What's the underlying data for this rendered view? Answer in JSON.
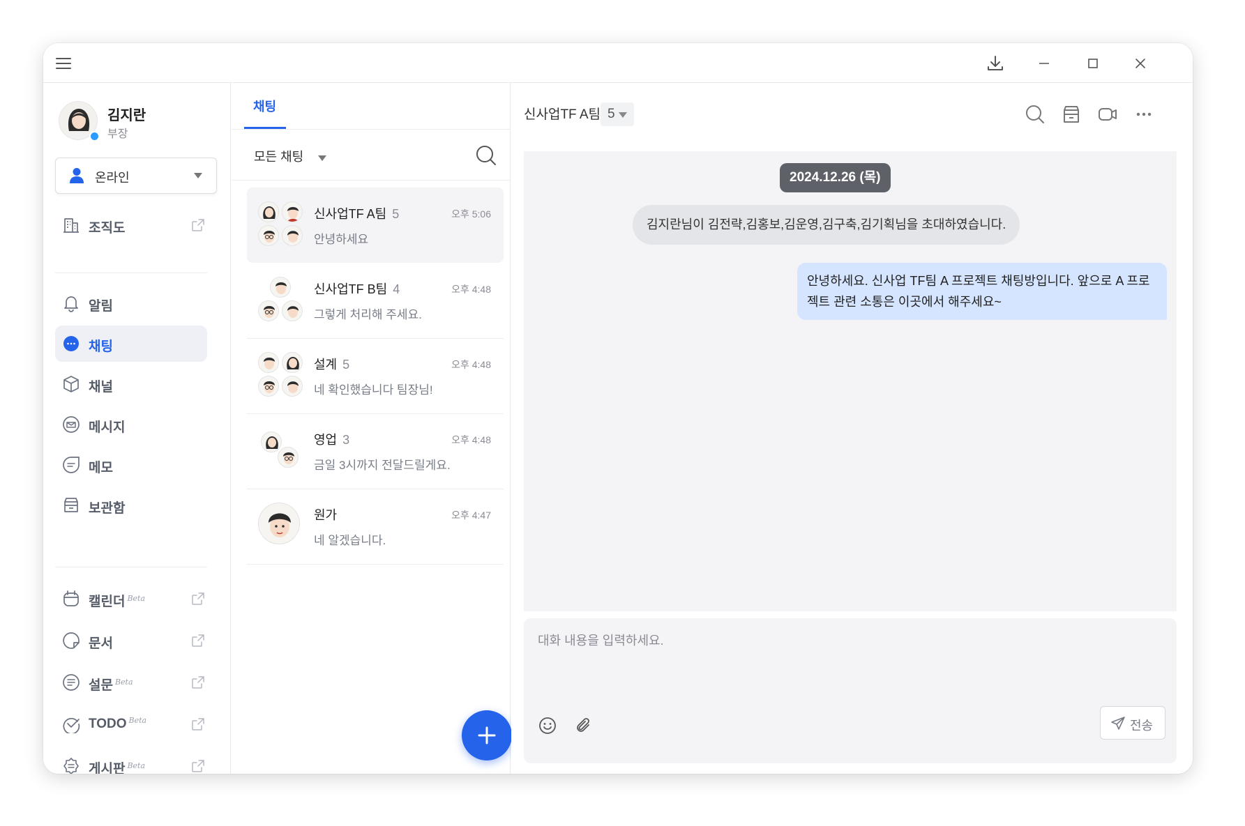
{
  "sidebar": {
    "profile": {
      "name": "김지란",
      "role": "부장"
    },
    "status": {
      "label": "온라인"
    },
    "nav": {
      "orgchart": "조직도",
      "alerts": "알림",
      "chat": "채팅",
      "channel": "채널",
      "message": "메시지",
      "memo": "메모",
      "archive": "보관함",
      "calendar": "캘린더",
      "docs": "문서",
      "survey": "설문",
      "todo": "TODO",
      "board": "게시판",
      "beta": "Beta"
    }
  },
  "list": {
    "tab": "채팅",
    "filter": "모든 채팅",
    "rooms": [
      {
        "name": "신사업TF A팀",
        "count": "5",
        "time": "오후 5:06",
        "message": "안녕하세요"
      },
      {
        "name": "신사업TF B팀",
        "count": "4",
        "time": "오후 4:48",
        "message": "그렇게 처리해 주세요."
      },
      {
        "name": "설계",
        "count": "5",
        "time": "오후 4:48",
        "message": "네 확인했습니다 팀장님!"
      },
      {
        "name": "영업",
        "count": "3",
        "time": "오후 4:48",
        "message": "금일 3시까지 전달드릴게요."
      },
      {
        "name": "원가",
        "count": "",
        "time": "오후 4:47",
        "message": "네 알겠습니다."
      }
    ]
  },
  "chat": {
    "title": "신사업TF A팀",
    "members": "5",
    "date": "2024.12.26 (목)",
    "system_message": "김지란님이 김전략,김홍보,김운영,김구축,김기획님을 초대하였습니다.",
    "my_message": "안녕하세요. 신사업 TF팀 A 프로젝트 채팅방입니다. 앞으로 A 프로젝트 관련 소통은 이곳에서 해주세요~",
    "input_placeholder": "대화 내용을 입력하세요.",
    "send": "전송"
  },
  "colors": {
    "accent": "#2563eb",
    "bubble": "#d6e5ff",
    "online": "#2a9bff"
  },
  "icons": [
    "menu-icon",
    "download-icon",
    "minimize-icon",
    "maximize-icon",
    "close-icon",
    "search-icon",
    "archive-icon",
    "video-icon",
    "more-icon",
    "emoji-icon",
    "attach-icon",
    "send-icon",
    "plus-icon"
  ]
}
